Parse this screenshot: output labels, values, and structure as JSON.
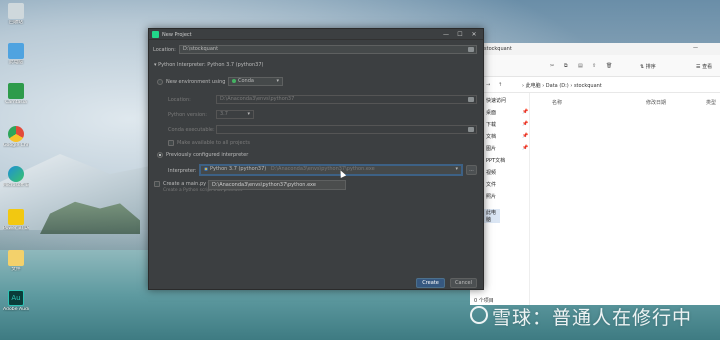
{
  "desktop": {
    "icons": [
      {
        "label": "回收站",
        "color": "#cfd8dc"
      },
      {
        "label": "此电脑",
        "color": "#4fa3e0"
      },
      {
        "label": "Camtasia",
        "color": "#2e9b4b"
      },
      {
        "label": "Google Chrome",
        "color": "#e24a3a"
      },
      {
        "label": "Microsoft Edge",
        "color": "#1e8fd6"
      },
      {
        "label": "Power BI Desktop",
        "color": "#f2c811"
      },
      {
        "label": "文件",
        "color": "#f3d16b"
      },
      {
        "label": "Adobe Audition",
        "color": "#0a3d3a"
      }
    ]
  },
  "dialog": {
    "title": "New Project",
    "location_label": "Location:",
    "location_value": "D:\\stockquant",
    "interpreter_section": "Python Interpreter: Python 3.7 (python37)",
    "new_env_label": "New environment using",
    "new_env_tool": "Conda",
    "env_location_label": "Location:",
    "env_location_value": "D:\\Anaconda3\\envs\\python37",
    "python_version_label": "Python version:",
    "python_version_value": "3.7",
    "conda_exec_label": "Conda executable:",
    "make_available_label": "Make available to all projects",
    "prev_configured_label": "Previously configured interpreter",
    "interpreter_label": "Interpreter:",
    "interpreter_value": "Python 3.7 (python37)",
    "interpreter_path": "D:\\Anaconda3\\envs\\python37\\python.exe",
    "browse_label": "...",
    "create_main_label": "Create a main.py welcome sc",
    "create_main_desc": "Create a Python script that provides",
    "tooltip": "D:\\Anaconda3\\envs\\python37\\python.exe",
    "create_button": "Create",
    "cancel_button": "Cancel"
  },
  "explorer": {
    "title_text": "stockquant",
    "sort_label": "排序",
    "view_label": "查看",
    "address": {
      "part1": "此电脑",
      "part2": "Data (D:)",
      "part3": "stockquant"
    },
    "columns": {
      "name": "名称",
      "modified": "修改日期",
      "type": "类型"
    },
    "sidebar": [
      {
        "label": "快速访问",
        "pinned": false
      },
      {
        "label": "桌面",
        "pinned": true
      },
      {
        "label": "下载",
        "pinned": true
      },
      {
        "label": "文档",
        "pinned": true
      },
      {
        "label": "图片",
        "pinned": true
      },
      {
        "label": "PPT文档",
        "pinned": false
      },
      {
        "label": "视频",
        "pinned": false
      },
      {
        "label": "文件",
        "pinned": false
      },
      {
        "label": "照片",
        "pinned": false
      },
      {
        "label": "此电脑",
        "pinned": false
      }
    ],
    "status_left": "0 个项目"
  },
  "watermark": {
    "text": "雪球：普通人在修行中"
  }
}
